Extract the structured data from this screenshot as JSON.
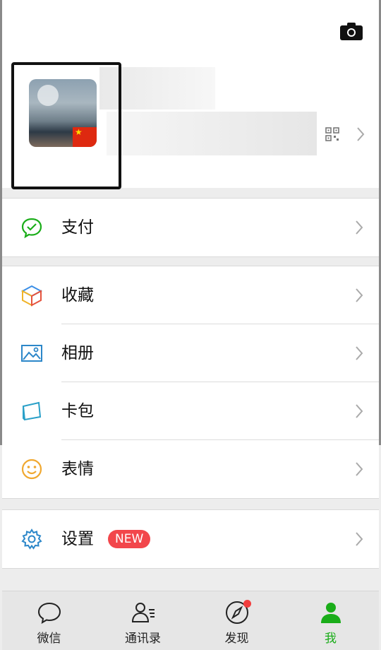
{
  "header": {
    "camera_icon": "camera-icon",
    "qr_icon": "qr-code-icon",
    "flag_icon": "china-flag-icon"
  },
  "menu": {
    "pay": {
      "label": "支付",
      "icon": "wallet-icon"
    },
    "favorites": {
      "label": "收藏",
      "icon": "cube-icon"
    },
    "album": {
      "label": "相册",
      "icon": "image-icon"
    },
    "cards": {
      "label": "卡包",
      "icon": "card-icon"
    },
    "stickers": {
      "label": "表情",
      "icon": "smile-icon"
    },
    "settings": {
      "label": "设置",
      "icon": "gear-icon",
      "badge": "NEW"
    }
  },
  "tabbar": {
    "tabs": [
      {
        "label": "微信",
        "icon": "chat-bubble-icon"
      },
      {
        "label": "通讯录",
        "icon": "contacts-icon"
      },
      {
        "label": "发现",
        "icon": "compass-icon"
      },
      {
        "label": "我",
        "icon": "person-icon"
      }
    ],
    "active_index": 3
  },
  "colors": {
    "accent": "#1aad19",
    "badge": "#f2464b",
    "highlight_border": "#111111"
  }
}
